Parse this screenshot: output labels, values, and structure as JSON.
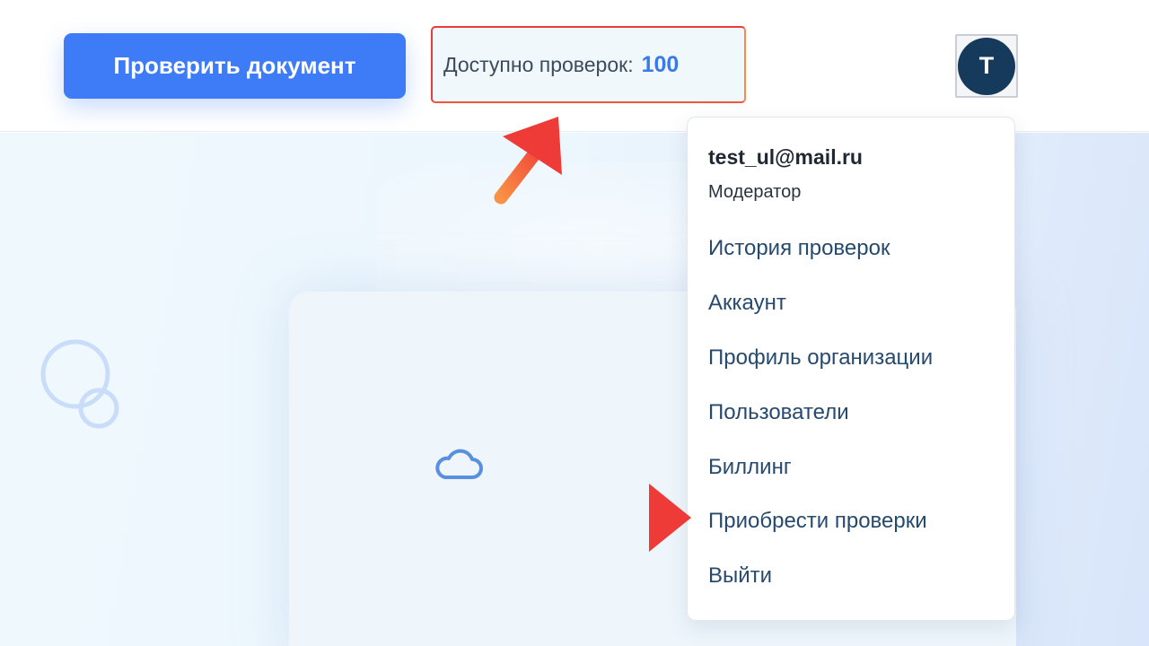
{
  "header": {
    "check_button_label": "Проверить документ",
    "checks_label": "Доступно проверок:",
    "checks_count": "100",
    "avatar_letter": "T"
  },
  "user_menu": {
    "email": "test_ul@mail.ru",
    "role": "Модератор",
    "items": [
      {
        "label": "История проверок"
      },
      {
        "label": "Аккаунт"
      },
      {
        "label": "Профиль организации"
      },
      {
        "label": "Пользователи"
      },
      {
        "label": "Биллинг"
      },
      {
        "label": "Приобрести проверки"
      },
      {
        "label": "Выйти"
      }
    ]
  },
  "colors": {
    "primary": "#3d7cf6",
    "count_accent": "#3a7ae8",
    "avatar_bg": "#163a5c",
    "menu_text": "#264a6e",
    "annotation_arrow": "#f2543c"
  },
  "icons": [
    "logo-mark-icon",
    "cloud-icon",
    "annotation-arrow-up",
    "annotation-arrow-right"
  ]
}
